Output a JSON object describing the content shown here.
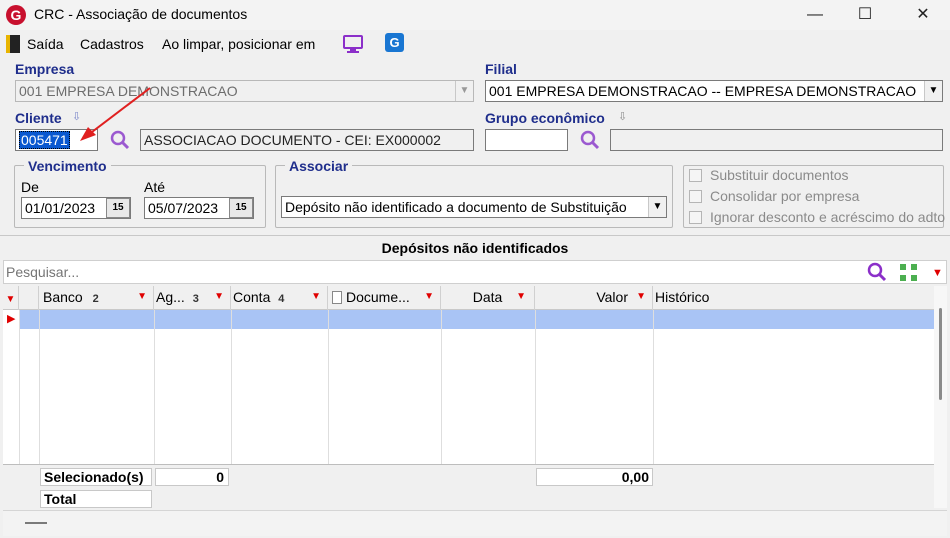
{
  "window": {
    "title": "CRC - Associação de documentos",
    "minimize": "—",
    "maximize": "☐",
    "close": "✕"
  },
  "toolbar": {
    "exit_label": "Saída",
    "cadastros_label": "Cadastros",
    "clear_label": "Ao limpar, posicionar em"
  },
  "empresa": {
    "label": "Empresa",
    "value": "001 EMPRESA DEMONSTRACAO"
  },
  "filial": {
    "label": "Filial",
    "value": "001 EMPRESA DEMONSTRACAO -- EMPRESA DEMONSTRACAO"
  },
  "cliente": {
    "label": "Cliente",
    "code": "005471",
    "name": "ASSOCIACAO DOCUMENTO - CEI: EX000002"
  },
  "grupo": {
    "label": "Grupo econômico",
    "code": "",
    "name": ""
  },
  "vencimento": {
    "label": "Vencimento",
    "de_label": "De",
    "de_value": "01/01/2023",
    "ate_label": "Até",
    "ate_value": "05/07/2023",
    "cal_label": "15"
  },
  "associar": {
    "label": "Associar",
    "value": "Depósito não identificado a documento de Substituição"
  },
  "options": [
    {
      "label": "Substituir documentos",
      "checked": false
    },
    {
      "label": "Consolidar por empresa",
      "checked": false
    },
    {
      "label": "Ignorar desconto e acréscimo do adto",
      "checked": false
    }
  ],
  "grid": {
    "title": "Depósitos não identificados",
    "search_placeholder": "Pesquisar...",
    "columns": [
      {
        "label": "Banco",
        "sort": "2"
      },
      {
        "label": "Ag...",
        "sort": "3"
      },
      {
        "label": "Conta",
        "sort": "4"
      },
      {
        "label": "Docume..."
      },
      {
        "label": "Data"
      },
      {
        "label": "Valor"
      },
      {
        "label": "Histórico"
      }
    ],
    "selected_label": "Selecionado(s)",
    "selected_count": "0",
    "selected_value": "0,00",
    "total_label": "Total"
  },
  "colors": {
    "accent_blue": "#1f2e8c",
    "filter_red": "#e00000",
    "selected_row": "#a9c4f5",
    "purple": "#8b2fc9"
  }
}
